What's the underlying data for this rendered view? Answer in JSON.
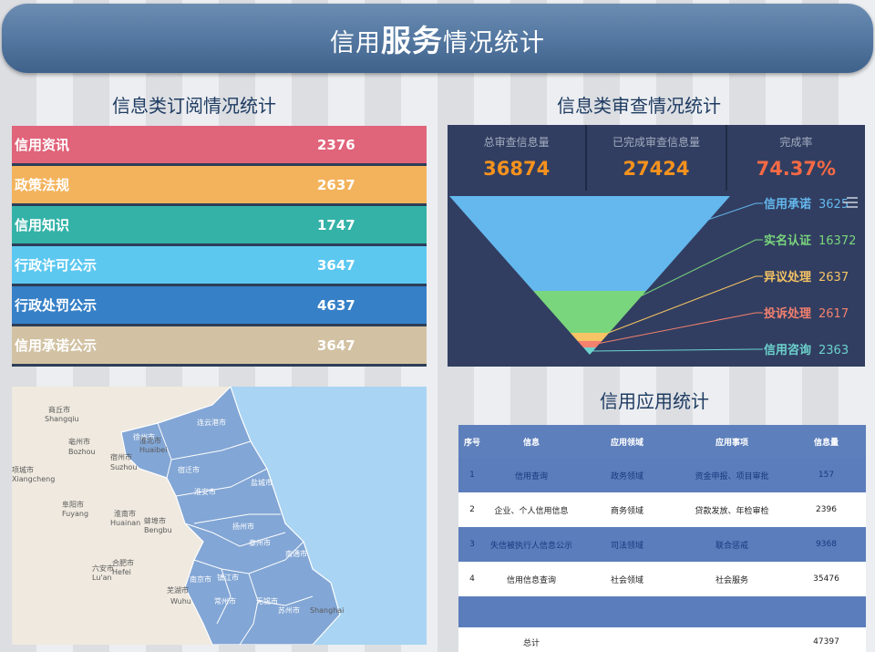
{
  "header": {
    "title_a": "信用",
    "title_b": "服务",
    "title_c": "情况统计"
  },
  "subscription": {
    "title": "信息类订阅情况统计",
    "rows": [
      {
        "name": "信用资讯",
        "value": "2376",
        "color": "#e0647a"
      },
      {
        "name": "政策法规",
        "value": "2637",
        "color": "#f3b35d"
      },
      {
        "name": "信用知识",
        "value": "1747",
        "color": "#34b2a7"
      },
      {
        "name": "行政许可公示",
        "value": "3647",
        "color": "#5cc8f0"
      },
      {
        "name": "行政处罚公示",
        "value": "4637",
        "color": "#3680c7"
      },
      {
        "name": "信用承诺公示",
        "value": "3647",
        "color": "#d2c2a3"
      }
    ]
  },
  "review": {
    "title": "信息类审查情况统计",
    "kpis": [
      {
        "label": "总审查信息量",
        "value": "36874",
        "color": "#f6921e"
      },
      {
        "label": "已完成审查信息量",
        "value": "27424",
        "color": "#f6921e"
      },
      {
        "label": "完成率",
        "value": "74.37%",
        "color": "#f46a45"
      }
    ],
    "funnel": [
      {
        "name": "信用承诺",
        "value": "3625",
        "color": "#64b8ee"
      },
      {
        "name": "实名认证",
        "value": "16372",
        "color": "#7ad67c"
      },
      {
        "name": "异议处理",
        "value": "2637",
        "color": "#f6c464"
      },
      {
        "name": "投诉处理",
        "value": "2617",
        "color": "#f4806e"
      },
      {
        "name": "信用咨询",
        "value": "2363",
        "color": "#6cd2cd"
      }
    ],
    "menu_icon": "menu-lines-icon"
  },
  "map": {
    "labels": [
      {
        "name": "连云港市"
      },
      {
        "name": "徐州市"
      },
      {
        "name": "宿迁市"
      },
      {
        "name": "淮安市"
      },
      {
        "name": "盐城市"
      },
      {
        "name": "扬州市"
      },
      {
        "name": "泰州市"
      },
      {
        "name": "南京市"
      },
      {
        "name": "镇江市"
      },
      {
        "name": "常州市"
      },
      {
        "name": "无锡市"
      },
      {
        "name": "苏州市"
      },
      {
        "name": "南通市"
      },
      {
        "name": "商丘市"
      },
      {
        "name": "Shangqiu"
      },
      {
        "name": "亳州市"
      },
      {
        "name": "Bozhou"
      },
      {
        "name": "宿州市"
      },
      {
        "name": "Suzhou"
      },
      {
        "name": "淮北市"
      },
      {
        "name": "Huaibei"
      },
      {
        "name": "项城市"
      },
      {
        "name": "Xiangcheng"
      },
      {
        "name": "阜阳市"
      },
      {
        "name": "Fuyang"
      },
      {
        "name": "淮南市"
      },
      {
        "name": "Huainan"
      },
      {
        "name": "蚌埠市"
      },
      {
        "name": "Bengbu"
      },
      {
        "name": "六安市"
      },
      {
        "name": "Lu'an"
      },
      {
        "name": "合肥市"
      },
      {
        "name": "Hefei"
      },
      {
        "name": "芜湖市"
      },
      {
        "name": "Wuhu"
      },
      {
        "name": "Shanghai"
      }
    ]
  },
  "app": {
    "title": "信用应用统计",
    "columns": [
      "序号",
      "信息",
      "应用领域",
      "应用事项",
      "信息量"
    ],
    "rows": [
      {
        "no": "1",
        "info": "信用查询",
        "field": "政务领域",
        "item": "资金申报、项目审批",
        "count": "157"
      },
      {
        "no": "2",
        "info": "企业、个人信用信息",
        "field": "商务领域",
        "item": "贷款发放、年检审检",
        "count": "2396"
      },
      {
        "no": "3",
        "info": "失信被执行人信息公示",
        "field": "司法领域",
        "item": "联合惩戒",
        "count": "9368"
      },
      {
        "no": "4",
        "info": "信用信息查询",
        "field": "社会领域",
        "item": "社会服务",
        "count": "35476"
      }
    ],
    "total_label": "总计",
    "total_value": "47397"
  }
}
